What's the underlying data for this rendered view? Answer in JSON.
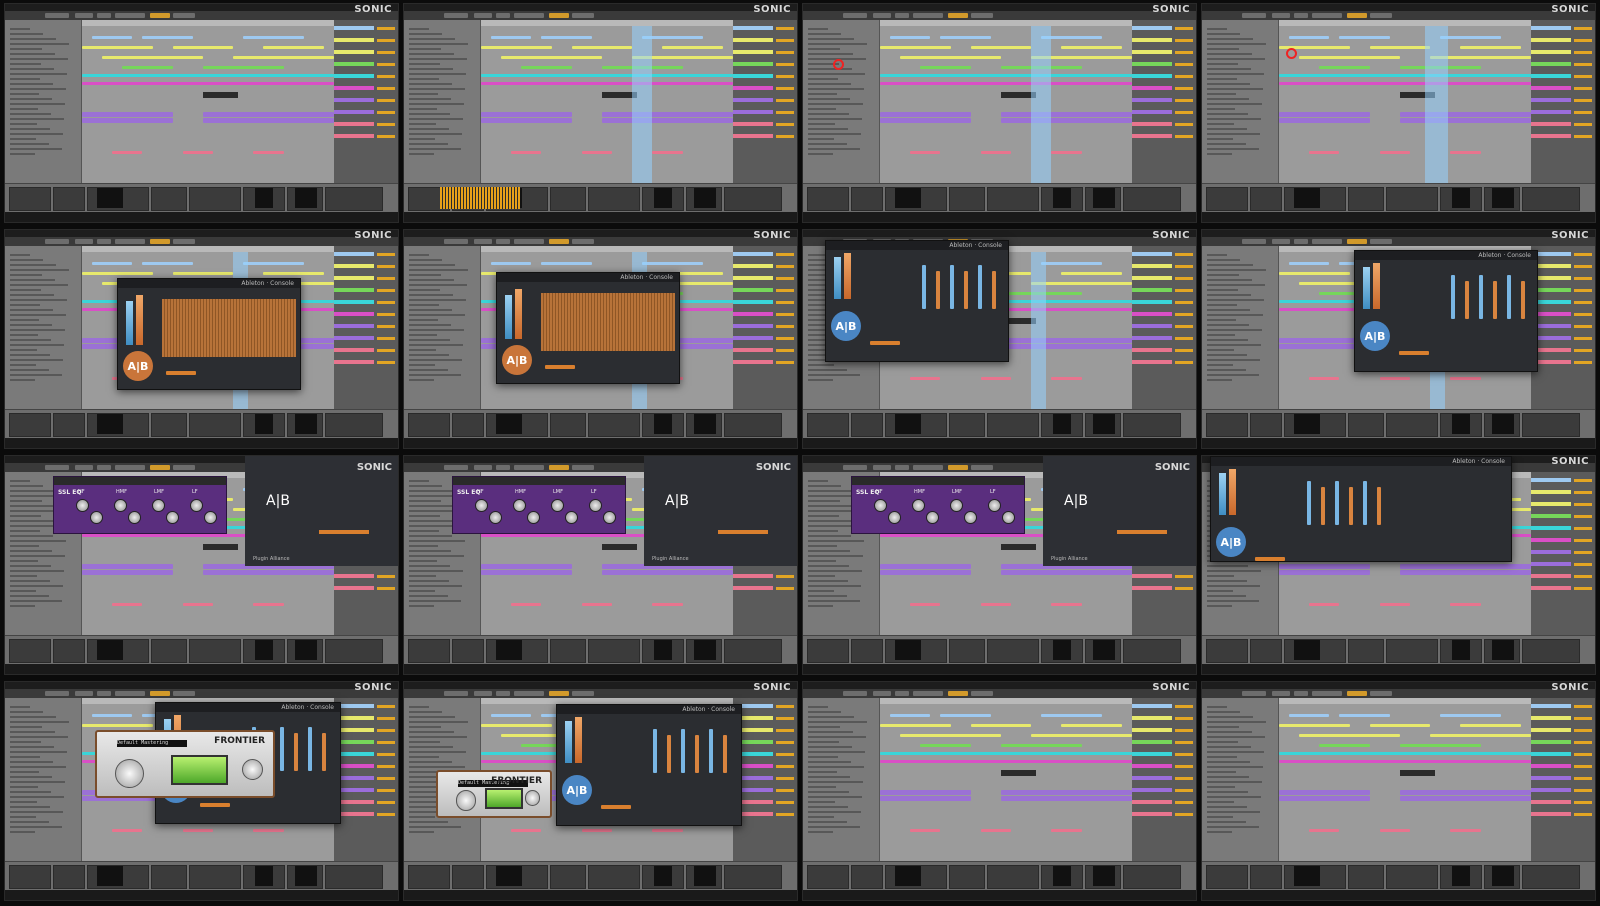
{
  "grid": {
    "columns": 4,
    "rows": 4
  },
  "brand_text": "SONIC",
  "colors": {
    "lane_yellow": "#e7e96c",
    "lane_blue": "#9ec9f0",
    "lane_cyan": "#3ad5d8",
    "lane_green": "#76d65a",
    "lane_magenta": "#d94fc6",
    "lane_purple": "#9b6ddb",
    "lane_pink": "#e8748e",
    "selection": "#96d2ff",
    "plugin_bg": "#2b2d31",
    "ab_orange": "#c9753a",
    "ab_blue": "#4a86c4",
    "eq_purple": "#5a2e7e",
    "record_ring": "#e22222"
  },
  "plugin": {
    "ab_label": "A|B",
    "title": "Ableton · Console",
    "eq_brand": "SSL EQ",
    "eq_bands": [
      "HF",
      "HMF",
      "LMF",
      "LF"
    ],
    "sonic_footer": "Plugin Alliance",
    "frontier_brand": "FRONTIER",
    "frontier_display": "Default Mastering"
  },
  "frames": [
    {
      "id": "f1",
      "variant": "arrangement"
    },
    {
      "id": "f2",
      "variant": "arrangement-waveform"
    },
    {
      "id": "f3",
      "variant": "arrangement-select"
    },
    {
      "id": "f4",
      "variant": "arrangement-cursor"
    },
    {
      "id": "f5",
      "variant": "plugin-orange"
    },
    {
      "id": "f6",
      "variant": "plugin-orange"
    },
    {
      "id": "f7",
      "variant": "plugin-blue"
    },
    {
      "id": "f8",
      "variant": "plugin-blue"
    },
    {
      "id": "f9",
      "variant": "eq-sonic"
    },
    {
      "id": "f10",
      "variant": "eq-sonic"
    },
    {
      "id": "f11",
      "variant": "eq-sonic"
    },
    {
      "id": "f12",
      "variant": "sonic-wide"
    },
    {
      "id": "f13",
      "variant": "frontier"
    },
    {
      "id": "f14",
      "variant": "frontier"
    },
    {
      "id": "f15",
      "variant": "arrangement-plain"
    },
    {
      "id": "f16",
      "variant": "arrangement-plain"
    }
  ]
}
